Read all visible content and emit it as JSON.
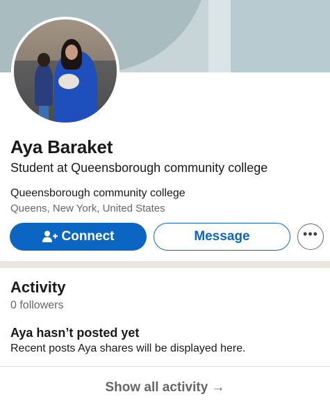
{
  "profile": {
    "name": "Aya Baraket",
    "headline": "Student at Queensborough community college",
    "school": "Queensborough community college",
    "location": "Queens, New York, United States"
  },
  "actions": {
    "connect_label": "Connect",
    "connect_icon": "add-person-icon",
    "message_label": "Message",
    "more_label": "•••",
    "more_icon": "more-options-icon"
  },
  "activity": {
    "title": "Activity",
    "followers": "0 followers",
    "empty_title": "Aya hasn’t posted yet",
    "empty_desc": "Recent posts Aya shares will be displayed here.",
    "show_all": "Show all activity →"
  },
  "colors": {
    "brand_blue": "#0a66c2",
    "banner": "#c7d5d8",
    "divider": "#e9e5df"
  }
}
